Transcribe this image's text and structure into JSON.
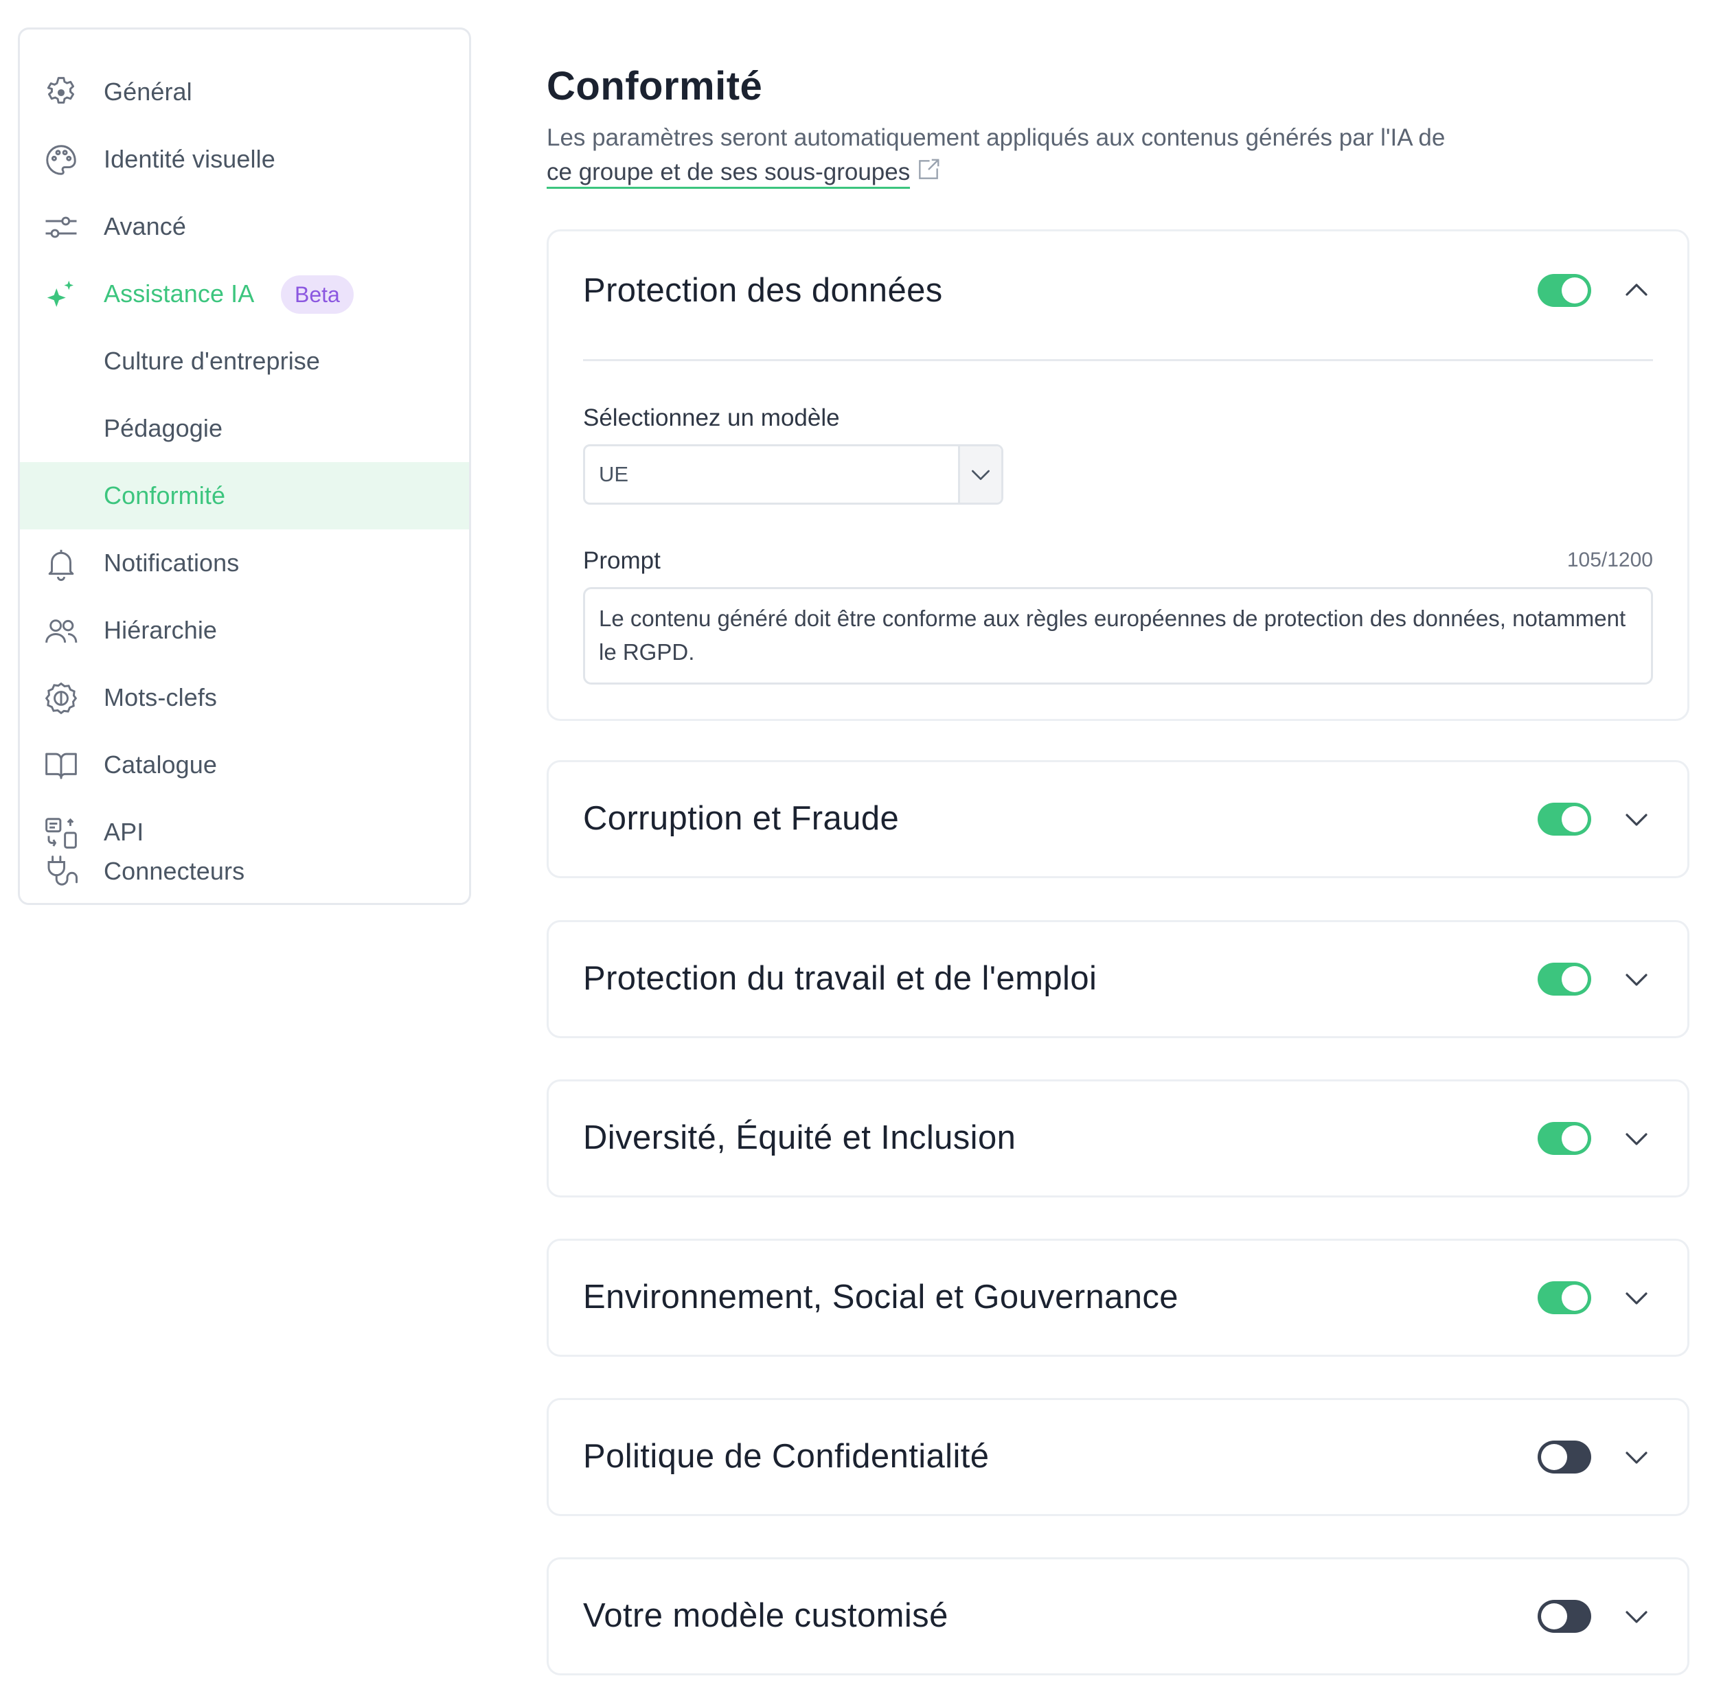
{
  "sidebar": {
    "items": [
      {
        "label": "Général",
        "icon": "gear-icon"
      },
      {
        "label": "Identité visuelle",
        "icon": "palette-icon"
      },
      {
        "label": "Avancé",
        "icon": "sliders-icon"
      },
      {
        "label": "Assistance IA",
        "icon": "sparkles-icon",
        "badge": "Beta",
        "color": "#3cc57e"
      },
      {
        "label": "Culture d'entreprise"
      },
      {
        "label": "Pédagogie"
      },
      {
        "label": "Conformité",
        "active": true,
        "color": "#3cc57e"
      },
      {
        "label": "Notifications",
        "icon": "bell-icon"
      },
      {
        "label": "Hiérarchie",
        "icon": "users-icon"
      },
      {
        "label": "Mots-clefs",
        "icon": "tag-icon"
      },
      {
        "label": "Catalogue",
        "icon": "book-icon"
      },
      {
        "label": "API",
        "icon": "api-icon"
      },
      {
        "label": "Connecteurs",
        "icon": "plug-icon"
      }
    ]
  },
  "main": {
    "title": "Conformité",
    "description": "Les paramètres seront automatiquement appliqués aux contenus générés par l'IA de",
    "description_link": "ce groupe et de ses sous-groupes",
    "cards": [
      {
        "title": "Protection des données",
        "enabled": true,
        "expanded": true,
        "select_label": "Sélectionnez un modèle",
        "select_value": "UE",
        "prompt_label": "Prompt",
        "prompt_count": "105/1200",
        "prompt_text": "Le contenu généré doit être conforme aux règles européennes de protection des données, notamment le RGPD."
      },
      {
        "title": "Corruption et Fraude",
        "enabled": true,
        "expanded": false
      },
      {
        "title": "Protection du travail et de l'emploi",
        "enabled": true,
        "expanded": false
      },
      {
        "title": "Diversité, Équité et Inclusion",
        "enabled": true,
        "expanded": false
      },
      {
        "title": "Environnement, Social et Gouvernance",
        "enabled": true,
        "expanded": false
      },
      {
        "title": "Politique de Confidentialité",
        "enabled": false,
        "expanded": false
      },
      {
        "title": "Votre modèle customisé",
        "enabled": false,
        "expanded": false
      }
    ]
  },
  "colors": {
    "accent": "#3cc57e",
    "toggle_off": "#3a4252",
    "beta_bg": "#ece3fb",
    "beta_text": "#8b57e0",
    "active_bg": "#e9f8ef"
  }
}
